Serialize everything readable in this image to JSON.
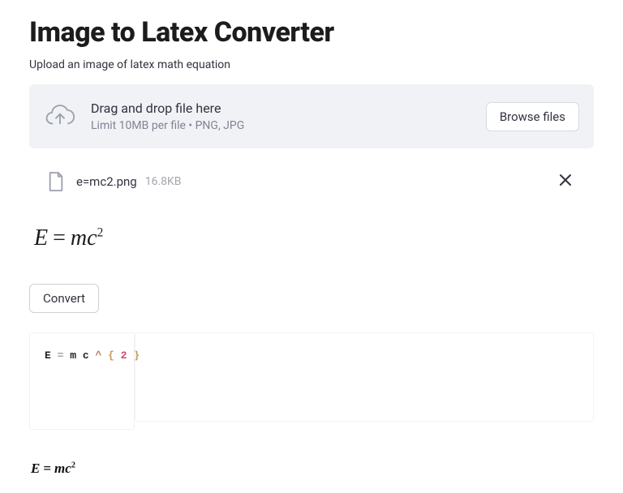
{
  "header": {
    "title": "Image to Latex Converter",
    "subtitle": "Upload an image of latex math equation"
  },
  "uploader": {
    "drop_label": "Drag and drop file here",
    "drop_sub": "Limit 10MB per file • PNG, JPG",
    "browse_label": "Browse files"
  },
  "file": {
    "name": "e=mc2.png",
    "size": "16.8KB"
  },
  "preview_equation": {
    "E": "E",
    "eq": "=",
    "m": "m",
    "c": "c",
    "sup": "2"
  },
  "convert": {
    "label": "Convert"
  },
  "latex_output": {
    "tok_E": "E",
    "tok_eq": "=",
    "tok_m": "m",
    "tok_c": "c",
    "tok_caret": "^",
    "tok_lbrace": "{",
    "tok_num": "2",
    "tok_rbrace": "}"
  },
  "rendered_equation": {
    "E": "E",
    "eq": "=",
    "m": "m",
    "c": "c",
    "sup": "2"
  }
}
